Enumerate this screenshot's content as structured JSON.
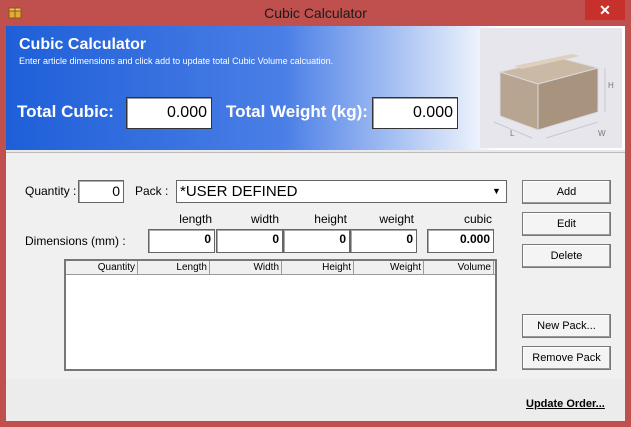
{
  "window": {
    "title": "Cubic Calculator",
    "close_symbol": "✕",
    "app_icon": "package-icon"
  },
  "header": {
    "title": "Cubic Calculator",
    "subtitle": "Enter article dimensions and click add to update total Cubic Volume calcuation.",
    "total_cubic_label": "Total Cubic:",
    "total_cubic_value": "0.000",
    "total_weight_label": "Total Weight (kg):",
    "total_weight_value": "0.000",
    "image": "cardboard-box-dimensions-image",
    "box_labels": {
      "h": "H",
      "l": "L",
      "w": "W"
    },
    "gradient_color": "#1e5fd8"
  },
  "form": {
    "quantity_label": "Quantity :",
    "quantity_value": "0",
    "pack_label": "Pack :",
    "pack_value": "*USER DEFINED",
    "dimensions_label": "Dimensions (mm) :",
    "columns": {
      "length": "length",
      "width": "width",
      "height": "height",
      "weight": "weight",
      "cubic": "cubic"
    },
    "values": {
      "length": "0",
      "width": "0",
      "height": "0",
      "weight": "0",
      "cubic": "0.000"
    }
  },
  "grid": {
    "headers": [
      "Quantity",
      "Length",
      "Width",
      "Height",
      "Weight",
      "Volume"
    ],
    "rows": []
  },
  "buttons": {
    "add": "Add",
    "edit": "Edit",
    "delete": "Delete",
    "new_pack": "New Pack...",
    "remove_pack": "Remove Pack",
    "update_order": "Update Order..."
  }
}
